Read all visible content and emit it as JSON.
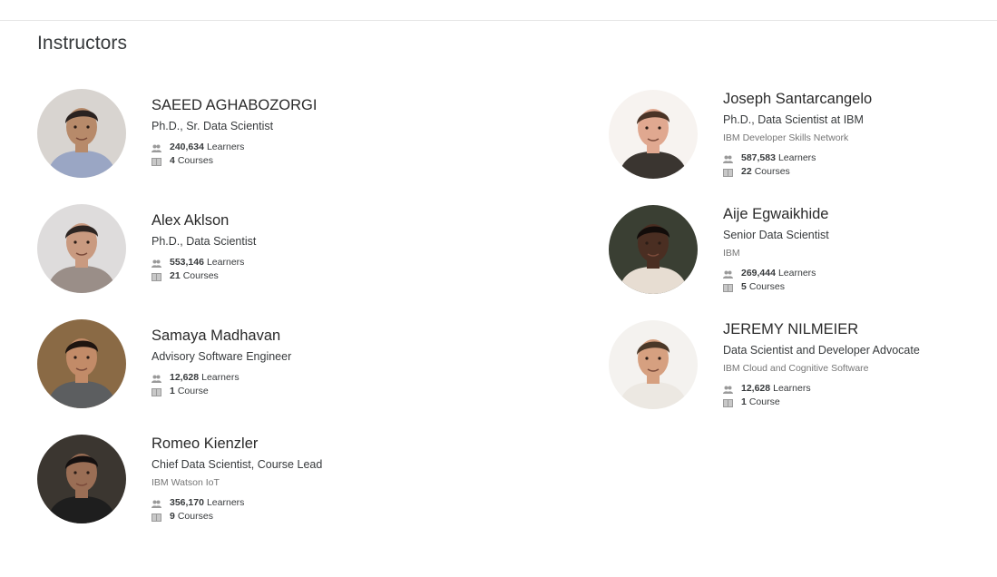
{
  "section_title": "Instructors",
  "instructors": [
    {
      "name": "SAEED AGHABOZORGI",
      "title": "Ph.D., Sr. Data Scientist",
      "org": "",
      "learners": "240,634",
      "learners_label": "Learners",
      "courses": "4",
      "courses_label": "Courses",
      "avatar_bg": "#d8d4d0",
      "skin": "#b78a6a",
      "shirt": "#9aa6c4",
      "hair": "#2a2220"
    },
    {
      "name": "Alex Aklson",
      "title": "Ph.D., Data Scientist",
      "org": "",
      "learners": "553,146",
      "learners_label": "Learners",
      "courses": "21",
      "courses_label": "Courses",
      "avatar_bg": "#dedcdc",
      "skin": "#c99a80",
      "shirt": "#9a8e88",
      "hair": "#2d2522"
    },
    {
      "name": "Samaya Madhavan",
      "title": "Advisory Software Engineer",
      "org": "",
      "learners": "12,628",
      "learners_label": "Learners",
      "courses": "1",
      "courses_label": "Course",
      "avatar_bg": "#8a6a45",
      "skin": "#c28b68",
      "shirt": "#5c5e60",
      "hair": "#1f1510"
    },
    {
      "name": "Romeo Kienzler",
      "title": "Chief Data Scientist, Course Lead",
      "org": "IBM Watson IoT",
      "learners": "356,170",
      "learners_label": "Learners",
      "courses": "9",
      "courses_label": "Courses",
      "avatar_bg": "#3b3630",
      "skin": "#9a6e55",
      "shirt": "#1e1e1e",
      "hair": "#141010"
    },
    {
      "name": "Joseph Santarcangelo",
      "title": "Ph.D., Data Scientist at IBM",
      "org": "IBM Developer Skills Network",
      "learners": "587,583",
      "learners_label": "Learners",
      "courses": "22",
      "courses_label": "Courses",
      "avatar_bg": "#f7f3f0",
      "skin": "#e0a890",
      "shirt": "#3a3530",
      "hair": "#4a3326"
    },
    {
      "name": "Aije Egwaikhide",
      "title": "Senior Data Scientist",
      "org": "IBM",
      "learners": "269,444",
      "learners_label": "Learners",
      "courses": "5",
      "courses_label": "Courses",
      "avatar_bg": "#3a3f33",
      "skin": "#4a2e22",
      "shirt": "#e7ddd2",
      "hair": "#120c0a"
    },
    {
      "name": "JEREMY NILMEIER",
      "title": "Data Scientist and Developer Advocate",
      "org": "IBM Cloud and Cognitive Software",
      "learners": "12,628",
      "learners_label": "Learners",
      "courses": "1",
      "courses_label": "Course",
      "avatar_bg": "#f4f2ef",
      "skin": "#d6a080",
      "shirt": "#ece8e2",
      "hair": "#4a3828"
    }
  ]
}
